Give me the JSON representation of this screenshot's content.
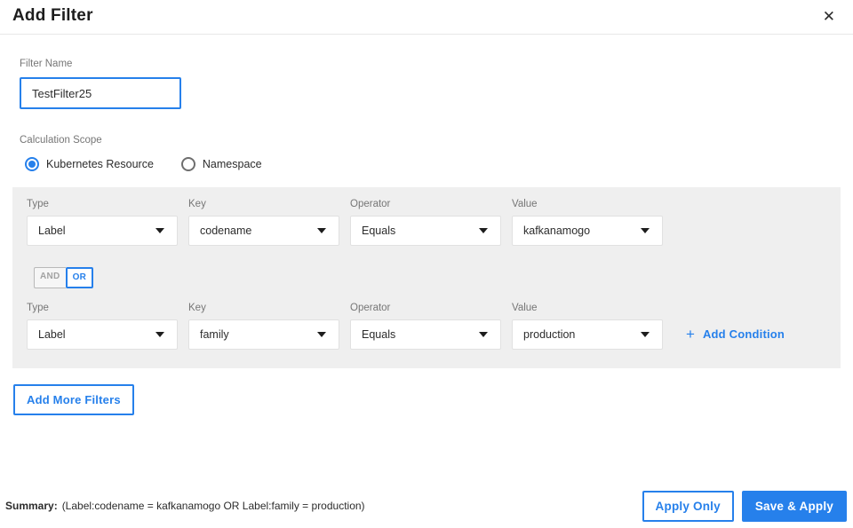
{
  "header": {
    "title": "Add Filter",
    "close_glyph": "✕"
  },
  "filter_name": {
    "label": "Filter Name",
    "value": "TestFilter25"
  },
  "calculation_scope": {
    "label": "Calculation Scope",
    "options": [
      {
        "label": "Kubernetes Resource",
        "selected": true
      },
      {
        "label": "Namespace",
        "selected": false
      }
    ]
  },
  "conditions": {
    "rows": [
      {
        "type_label": "Type",
        "type_value": "Label",
        "key_label": "Key",
        "key_value": "codename",
        "operator_label": "Operator",
        "operator_value": "Equals",
        "value_label": "Value",
        "value_value": "kafkanamogo"
      },
      {
        "type_label": "Type",
        "type_value": "Label",
        "key_label": "Key",
        "key_value": "family",
        "operator_label": "Operator",
        "operator_value": "Equals",
        "value_label": "Value",
        "value_value": "production"
      }
    ],
    "logic_toggle": {
      "and_label": "AND",
      "or_label": "OR",
      "selected": "OR"
    },
    "add_condition": {
      "plus_glyph": "+",
      "label": "Add Condition"
    }
  },
  "buttons": {
    "add_more_filters": "Add More Filters",
    "apply_only": "Apply Only",
    "save_and_apply": "Save & Apply"
  },
  "summary": {
    "label": "Summary:",
    "text": "(Label:codename = kafkanamogo OR Label:family = production)"
  },
  "colors": {
    "accent_blue": "#2680eb",
    "panel_gray": "#efefef"
  }
}
